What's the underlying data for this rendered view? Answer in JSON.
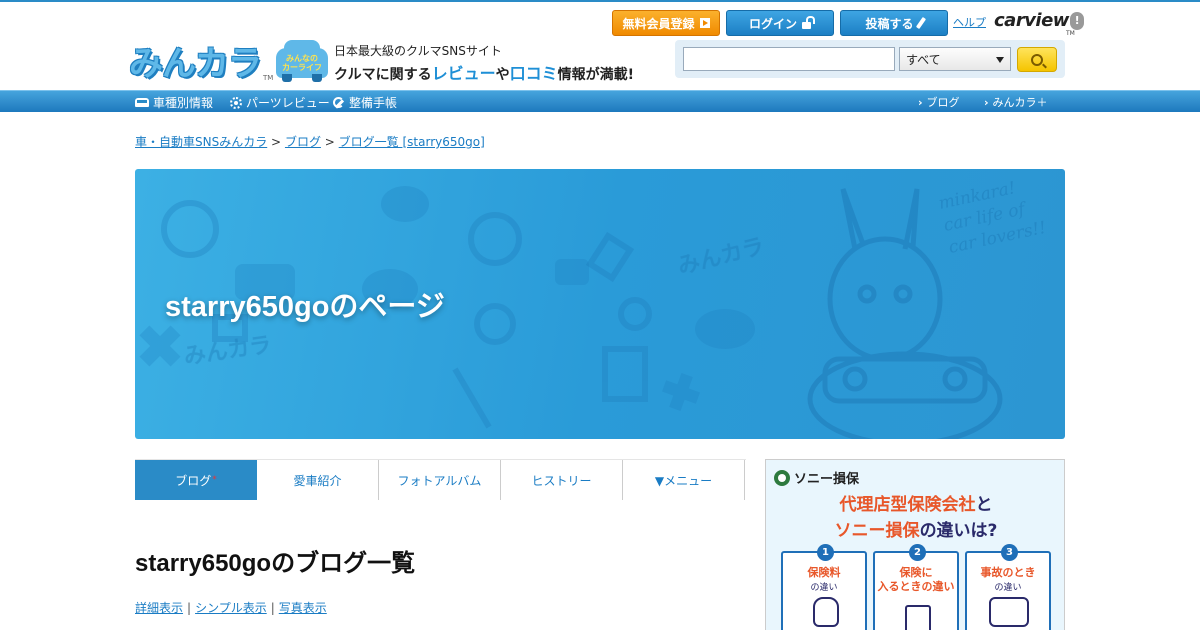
{
  "header": {
    "logo_text": "みんカラ",
    "logo_tm": "TM",
    "badge_line1": "みんなの",
    "badge_line2": "カーライフ",
    "tagline1": "日本最大級のクルマSNSサイト",
    "tagline2_a": "クルマに関する",
    "tagline2_b": "レビュー",
    "tagline2_c": "や",
    "tagline2_d": "口コミ",
    "tagline2_e": "情報が満載!",
    "btn_register": "無料会員登録",
    "btn_login": "ログイン",
    "btn_post": "投稿する",
    "help": "ヘルプ",
    "carview": "carview",
    "carview_tm": "TM",
    "search": {
      "value": "",
      "select_value": "すべて"
    }
  },
  "nav": {
    "left": [
      "車種別情報",
      "パーツレビュー",
      "整備手帳"
    ],
    "right": [
      "ブログ",
      "みんカラ＋"
    ]
  },
  "breadcrumb": {
    "items": [
      "車・自動車SNSみんカラ",
      "ブログ",
      "ブログ一覧 [starry650go]"
    ],
    "sep": ">"
  },
  "banner": {
    "title": "starry650goのページ",
    "watermark": "minkara! car life of car lovers!!",
    "colors": {
      "bg": "#2a9bd8"
    }
  },
  "tabs": [
    {
      "label": "ブログ",
      "mark": "*",
      "active": true
    },
    {
      "label": "愛車紹介"
    },
    {
      "label": "フォトアルバム"
    },
    {
      "label": "ヒストリー"
    },
    {
      "label": "▼メニュー"
    }
  ],
  "main": {
    "heading": "starry650goのブログ一覧",
    "view_links": [
      "詳細表示",
      "シンプル表示",
      "写真表示"
    ],
    "sep": "|"
  },
  "ad": {
    "brand": "ソニー損保",
    "head1_a": "代理店型保険会社",
    "head1_b": "と",
    "head2_a": "ソニー損保",
    "head2_b": "の違いは?",
    "cards": [
      {
        "num": "1",
        "t1": "保険料",
        "t2": "の違い"
      },
      {
        "num": "2",
        "t1": "保険に\n入るときの違い",
        "t2": ""
      },
      {
        "num": "3",
        "t1": "事故のとき",
        "t2": "の違い"
      }
    ]
  },
  "colors": {
    "accent": "#2a8bc7",
    "link": "#1a7cc4",
    "register": "#f08a00",
    "search_btn": "#f5c400"
  }
}
